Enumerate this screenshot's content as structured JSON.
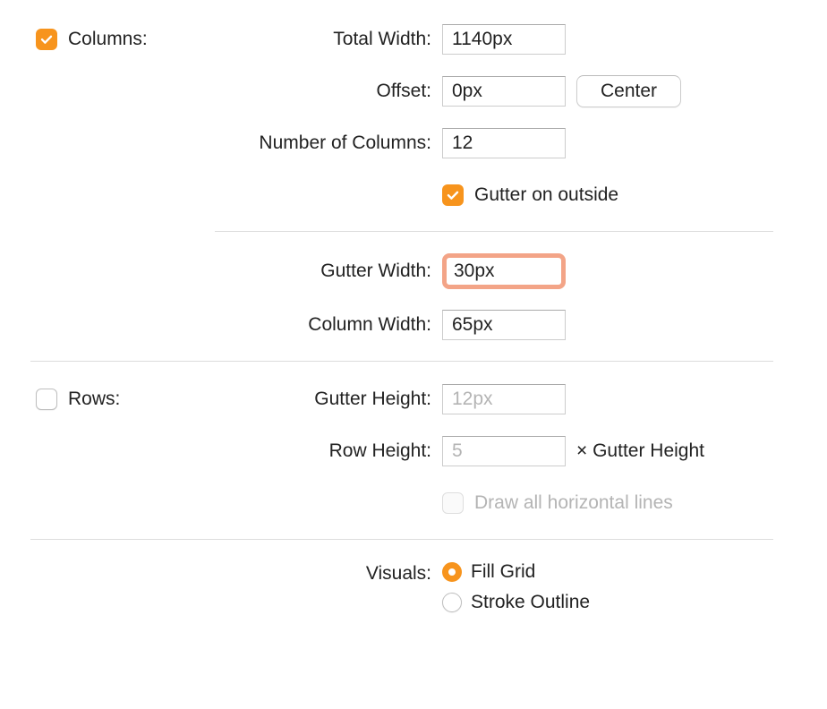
{
  "columns": {
    "section_label": "Columns:",
    "enabled": true,
    "total_width": {
      "label": "Total Width:",
      "value": "1140px"
    },
    "offset": {
      "label": "Offset:",
      "value": "0px",
      "center_button": "Center"
    },
    "number_of_columns": {
      "label": "Number of Columns:",
      "value": "12"
    },
    "gutter_on_outside": {
      "label": "Gutter on outside",
      "checked": true
    },
    "gutter_width": {
      "label": "Gutter Width:",
      "value": "30px"
    },
    "column_width": {
      "label": "Column Width:",
      "value": "65px"
    }
  },
  "rows": {
    "section_label": "Rows:",
    "enabled": false,
    "gutter_height": {
      "label": "Gutter Height:",
      "value": "12px"
    },
    "row_height": {
      "label": "Row Height:",
      "value": "5",
      "suffix": "× Gutter Height"
    },
    "draw_lines": {
      "label": "Draw all horizontal lines",
      "checked": false
    }
  },
  "visuals": {
    "section_label": "Visuals:",
    "options": {
      "fill": "Fill Grid",
      "stroke": "Stroke Outline"
    },
    "selected": "fill"
  }
}
